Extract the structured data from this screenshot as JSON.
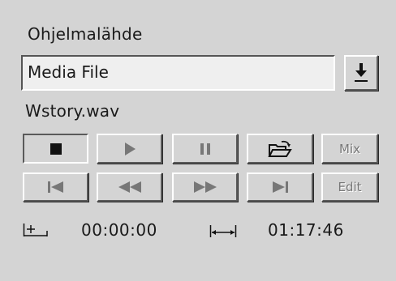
{
  "source": {
    "label": "Ohjelmalähde",
    "value": "Media File",
    "dropdown_icon": "download-arrow-icon"
  },
  "file_name": "Wstory.wav",
  "transport_row1": [
    {
      "name": "stop-button",
      "icon": "stop-icon"
    },
    {
      "name": "play-button",
      "icon": "play-icon"
    },
    {
      "name": "pause-button",
      "icon": "pause-icon"
    },
    {
      "name": "open-button",
      "icon": "open-folder-icon"
    },
    {
      "name": "mix-button",
      "label": "Mix"
    }
  ],
  "transport_row2": [
    {
      "name": "skip-to-start-button",
      "icon": "skip-start-icon"
    },
    {
      "name": "rewind-button",
      "icon": "rewind-icon"
    },
    {
      "name": "fast-forward-button",
      "icon": "fast-forward-icon"
    },
    {
      "name": "skip-to-end-button",
      "icon": "skip-end-icon"
    },
    {
      "name": "edit-button",
      "label": "Edit"
    }
  ],
  "times": {
    "start_icon": "start-position-icon",
    "start": "00:00:00",
    "length_icon": "length-icon",
    "length": "01:17:46"
  },
  "colors": {
    "background": "#d4d4d4",
    "field": "#efefef",
    "icon_dark": "#111111",
    "icon_disabled": "#777777"
  }
}
